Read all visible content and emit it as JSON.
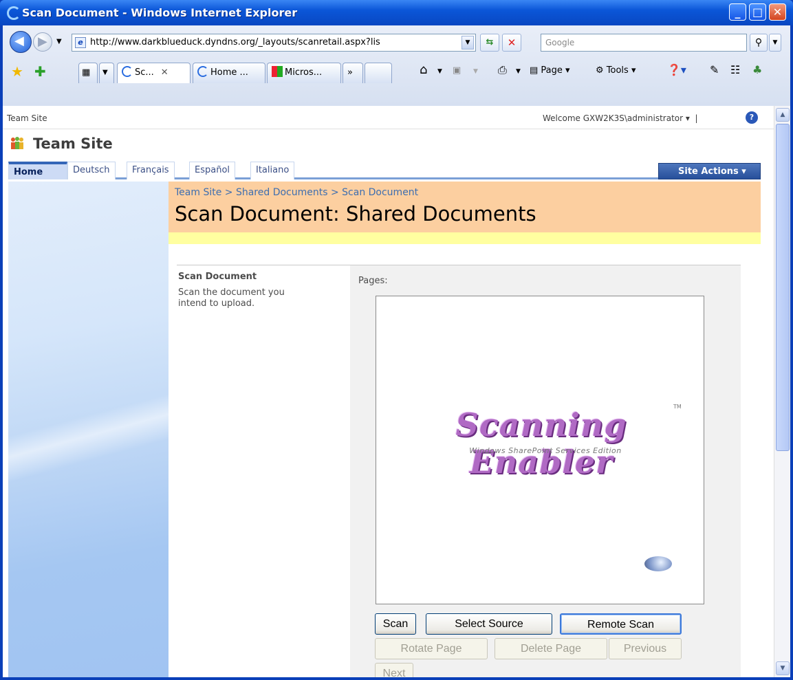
{
  "window": {
    "title": "Scan Document - Windows Internet Explorer"
  },
  "navbar": {
    "address": "http://www.darkblueduck.dyndns.org/_layouts/scanretail.aspx?lis",
    "search_placeholder": "Google"
  },
  "tabs": [
    {
      "label": "Sc...",
      "active": true
    },
    {
      "label": "Home ...",
      "active": false
    },
    {
      "label": "Micros...",
      "active": false
    }
  ],
  "tab_overflow": "»",
  "commandbar": {
    "page": "Page",
    "tools": "Tools"
  },
  "sharepoint": {
    "global_site": "Team Site",
    "welcome": "Welcome GXW2K3S\\administrator",
    "site_name": "Team Site",
    "nav": [
      "Home",
      "Deutsch",
      "Français",
      "Español",
      "Italiano"
    ],
    "site_actions": "Site Actions",
    "breadcrumb": "Team Site > Shared Documents > Scan Document",
    "page_title": "Scan Document: Shared Documents"
  },
  "form": {
    "section_title": "Scan Document",
    "section_desc": "Scan the document you intend to upload.",
    "pages_label": "Pages:",
    "preview_logo": "Scanning Enabler",
    "preview_logo_sub": "Windows SharePoint Services Edition",
    "preview_tm": "TM",
    "buttons": {
      "scan": "Scan",
      "select_source": "Select Source",
      "remote_scan": "Remote Scan",
      "rotate_page": "Rotate Page",
      "delete_page": "Delete Page",
      "previous": "Previous",
      "next": "Next"
    }
  },
  "colors": {
    "title_bg": "#fccfa0",
    "yellow_bar": "#ffffa0",
    "site_actions": "#274f9a"
  }
}
